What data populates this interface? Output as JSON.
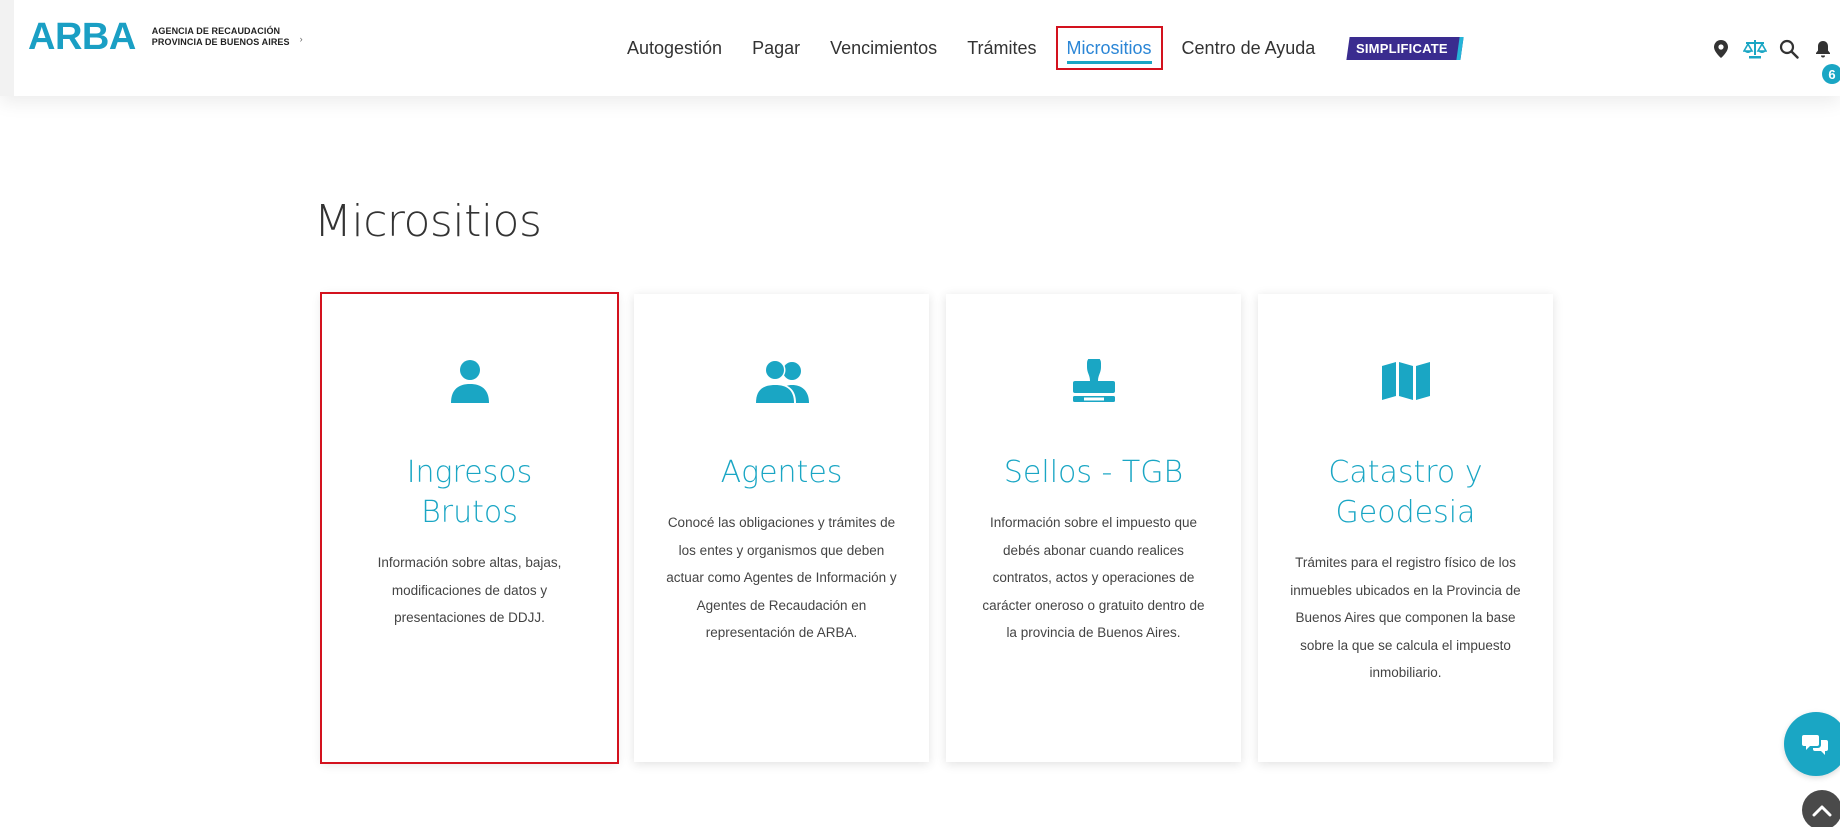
{
  "header": {
    "logo": {
      "mark": "ARBA",
      "line1": "AGENCIA DE RECAUDACIÓN",
      "line2": "PROVINCIA DE BUENOS AIRES",
      "caret": "›"
    },
    "nav": [
      {
        "label": "Autogestión"
      },
      {
        "label": "Pagar"
      },
      {
        "label": "Vencimientos"
      },
      {
        "label": "Trámites"
      },
      {
        "label": "Micrositios",
        "active": true
      },
      {
        "label": "Centro de Ayuda"
      }
    ],
    "simplificate_label": "SIMPLIFICATE",
    "icons": [
      "location-icon",
      "balance-scale-icon",
      "search-icon",
      "bell-icon"
    ],
    "notification_count": "6"
  },
  "main": {
    "title": "Micrositios",
    "cards": [
      {
        "icon": "user-icon",
        "title": "Ingresos Brutos",
        "description": "Información sobre altas, bajas, modificaciones de datos y presentaciones de DDJJ.",
        "selected": true
      },
      {
        "icon": "users-icon",
        "title": "Agentes",
        "description": "Conocé las obligaciones y trámites de los entes y organismos que deben actuar como Agentes de Información y Agentes de Recaudación en representación de ARBA."
      },
      {
        "icon": "stamp-icon",
        "title": "Sellos - TGB",
        "description": "Información sobre el impuesto que debés abonar cuando realices contratos, actos y operaciones de carácter oneroso o gratuito dentro de la provincia de Buenos Aires."
      },
      {
        "icon": "map-icon",
        "title": "Catastro y Geodesia",
        "description": "Trámites para el registro físico de los inmuebles ubicados en la Provincia de Buenos Aires que componen la base sobre la que se calcula el impuesto inmobiliario."
      }
    ]
  },
  "colors": {
    "accent": "#1aa6c4",
    "nav_active": "#2b86d6",
    "highlight_border": "#d3121e",
    "simplificate_bg": "#3a2c8f"
  },
  "floating": {
    "chat_icon": "chat-icon",
    "scroll_top_icon": "chevron-up-icon"
  }
}
